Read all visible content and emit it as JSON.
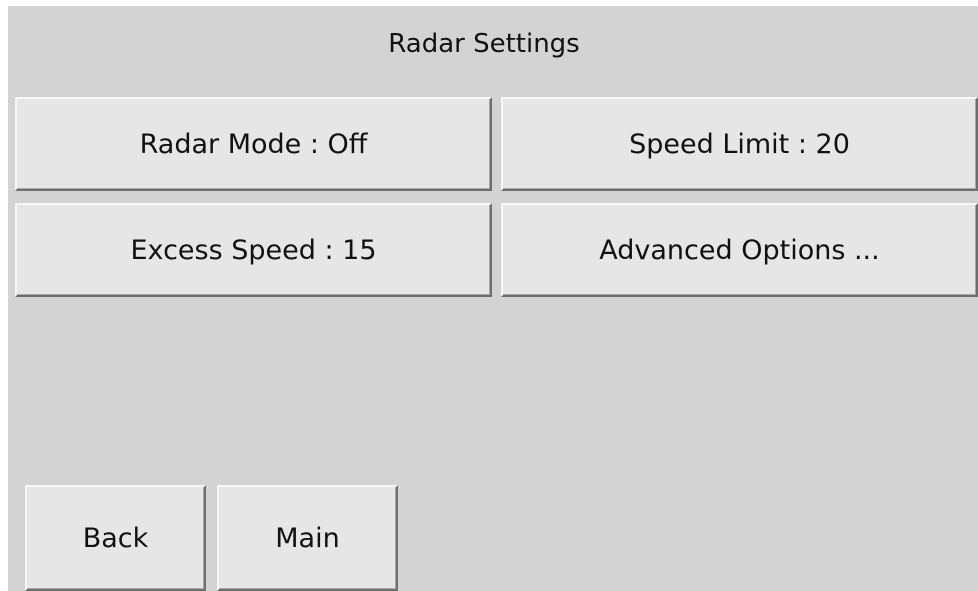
{
  "screen": {
    "title": "Radar Settings"
  },
  "settings": {
    "radar_mode_label": "Radar Mode : Off",
    "speed_limit_label": "Speed Limit : 20",
    "excess_speed_label": "Excess Speed : 15",
    "advanced_options_label": "Advanced Options ..."
  },
  "nav": {
    "back_label": "Back",
    "main_label": "Main"
  },
  "colors": {
    "background": "#d3d3d3",
    "button_face": "#e6e6e6",
    "text": "#111111"
  }
}
